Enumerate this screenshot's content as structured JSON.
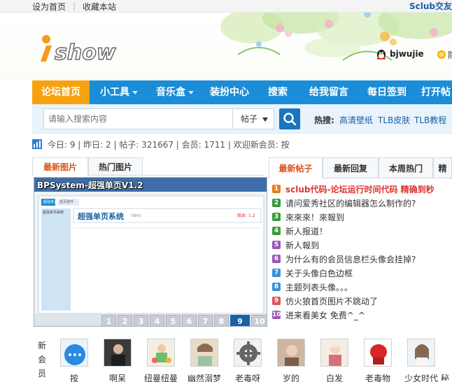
{
  "topbar": {
    "set_home": "设为首页",
    "bookmark": "收藏本站",
    "site_name": "Sclub交友"
  },
  "user": {
    "name": "bjwujie",
    "status": "隐身"
  },
  "nav": {
    "items": [
      {
        "label": "论坛首页",
        "active": true,
        "dropdown": false
      },
      {
        "label": "小工具",
        "active": false,
        "dropdown": true
      },
      {
        "label": "音乐盒",
        "active": false,
        "dropdown": true
      },
      {
        "label": "装扮中心",
        "active": false,
        "dropdown": false
      },
      {
        "label": "搜索",
        "active": false,
        "dropdown": false
      },
      {
        "label": "给我留言",
        "active": false,
        "dropdown": false
      },
      {
        "label": "每日签到",
        "active": false,
        "dropdown": false
      },
      {
        "label": "打开帖",
        "active": false,
        "dropdown": false
      }
    ]
  },
  "search": {
    "placeholder": "请输入搜索内容",
    "scope": "帖子",
    "hot_label": "热搜:",
    "hot_links": [
      "高清壁纸",
      "TLB皮肤",
      "TLB教程"
    ]
  },
  "stats": {
    "text": "今日: 9 | 昨日: 2 | 帖子: 321667 | 会员: 1711 | 欢迎新会员: 按"
  },
  "left_tabs": [
    "最新图片",
    "热门图片"
  ],
  "slideshow": {
    "title": "BPSystem-超强单页V1.2",
    "inner_heading": "超强单页系统",
    "inner_tag": "(dm)",
    "inner_version": "版本: 1.2",
    "inner_sidebar": "超强单页系统",
    "inner_tabs": [
      "超强单页",
      "首页插件"
    ],
    "numbers": [
      "1",
      "2",
      "3",
      "4",
      "5",
      "6",
      "7",
      "8",
      "9",
      "10"
    ],
    "active_number": "9"
  },
  "right_tabs": [
    "最新帖子",
    "最新回复",
    "本周热门",
    "精"
  ],
  "posts": [
    {
      "num": "1",
      "title": "sclub代码-论坛运行时间代码 精确到秒",
      "hot": true
    },
    {
      "num": "2",
      "title": "请问爱秀社区的编辑器怎么制作的?",
      "hot": false
    },
    {
      "num": "3",
      "title": "來來來！來報到",
      "hot": false
    },
    {
      "num": "4",
      "title": "新人报道！",
      "hot": false
    },
    {
      "num": "5",
      "title": "新人報到",
      "hot": false
    },
    {
      "num": "6",
      "title": "为什么有的会员信息栏头像会挂掉?",
      "hot": false
    },
    {
      "num": "7",
      "title": "关于头像白色边框",
      "hot": false
    },
    {
      "num": "8",
      "title": "主题列表头像。。。",
      "hot": false
    },
    {
      "num": "9",
      "title": "仿火狼首页图片不跳动了",
      "hot": false
    },
    {
      "num": "10",
      "title": "进来看美女 免费^_^",
      "hot": false
    }
  ],
  "badge_colors": [
    "#e67e22",
    "#3b9b3b",
    "#3b9b3b",
    "#3b9b3b",
    "#9a59b5",
    "#9a59b5",
    "#3b8fd9",
    "#3b8fd9",
    "#e05555",
    "#9a59b5"
  ],
  "members": {
    "label": "新会员",
    "list": [
      "按",
      "啊呆",
      "纽曼纽曼",
      "幽然溺梦",
      "老毒呀",
      "岁的",
      "白发",
      "老毒物",
      "少女时代",
      "秘"
    ]
  }
}
